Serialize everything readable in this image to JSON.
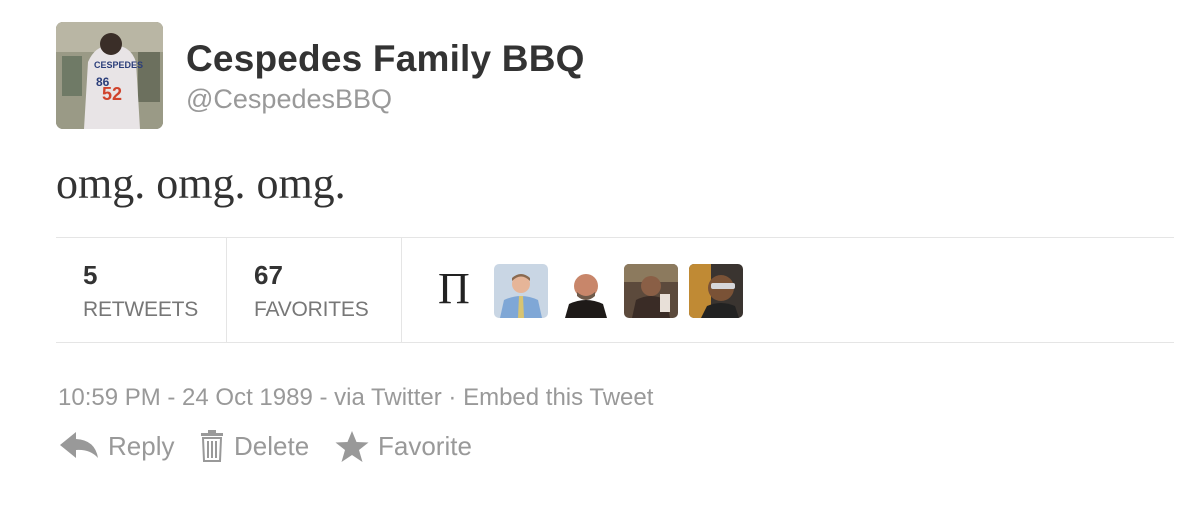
{
  "user": {
    "display_name": "Cespedes Family BBQ",
    "screen_name": "@CespedesBBQ",
    "avatar_icon": "profile-photo-baseball-player"
  },
  "tweet": {
    "text": "omg. omg. omg."
  },
  "stats": {
    "retweets_count": "5",
    "retweets_label": "RETWEETS",
    "favorites_count": "67",
    "favorites_label": "FAVORITES",
    "favoriter_glyph": "Π",
    "favoriter_avatars": [
      "avatar-man-blue-shirt",
      "avatar-man-bald",
      "avatar-person-dark",
      "avatar-person-sunglasses"
    ]
  },
  "meta": {
    "timestamp": "10:59 PM - 24 Oct 1989",
    "via": " - via Twitter",
    "separator": " · ",
    "embed_label": "Embed this Tweet"
  },
  "actions": {
    "reply_label": "Reply",
    "delete_label": "Delete",
    "favorite_label": "Favorite"
  },
  "colors": {
    "text": "#333333",
    "muted": "#999999",
    "divider": "#e5e5e5"
  }
}
